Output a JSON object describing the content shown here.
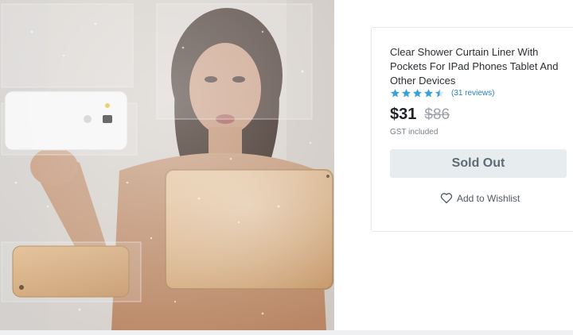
{
  "product": {
    "title": "Clear Shower Curtain Liner With Pockets For IPad Phones Tablet And Other Devices",
    "rating": 4.5,
    "reviews_label": "(31 reviews)",
    "price_current": "$31",
    "price_old": "$86",
    "tax_note": "GST included",
    "sold_out_label": "Sold Out",
    "wishlist_label": "Add to Wishlist"
  },
  "colors": {
    "star": "#3aa0d8",
    "review_link": "#2a7fb8",
    "button_bg": "#e7ecef",
    "button_text": "#5e6b75"
  },
  "icons": {
    "rating": "star-icon",
    "wishlist": "heart-outline-icon"
  }
}
